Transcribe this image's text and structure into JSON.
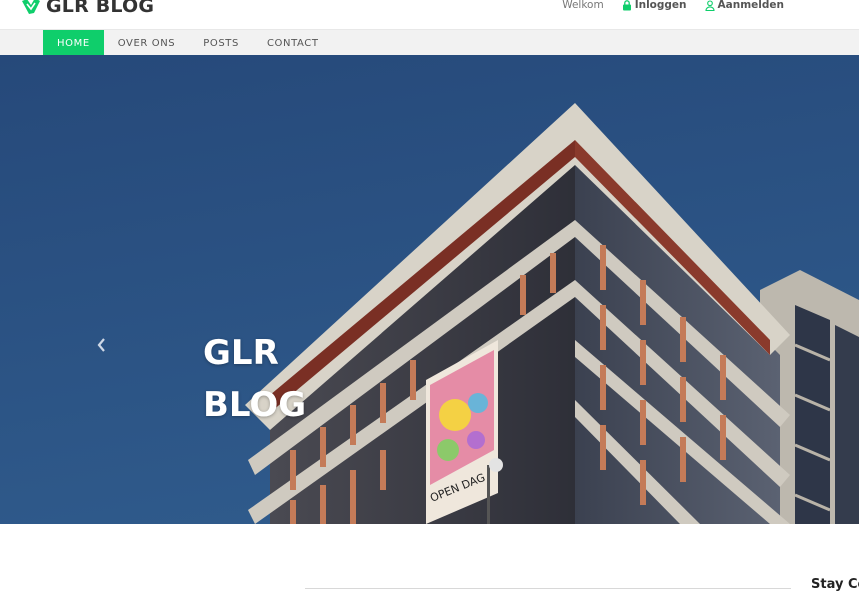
{
  "header": {
    "logo_text": "GLR BLOG",
    "welcome": "Welkom",
    "login": "Inloggen",
    "register": "Aanmelden"
  },
  "nav": {
    "items": [
      "HOME",
      "OVER ONS",
      "POSTS",
      "CONTACT"
    ],
    "active": "HOME"
  },
  "hero": {
    "title": "GLR BLOG",
    "sign_text": "OPEN DAG",
    "prev_icon": "chevron-left-icon"
  },
  "sidebar": {
    "heading": "Stay Co"
  },
  "colors": {
    "accent": "#0fce6b",
    "sky": "#2c4e7b",
    "text_dark": "#333333"
  }
}
